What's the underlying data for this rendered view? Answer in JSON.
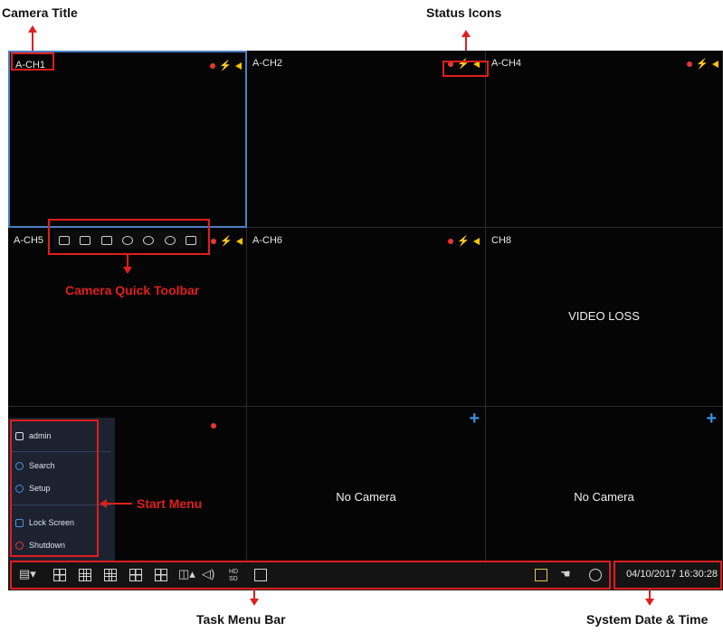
{
  "callouts": {
    "camera_title": "Camera Title",
    "status_icons": "Status Icons",
    "camera_quick_toolbar": "Camera Quick Toolbar",
    "start_menu": "Start Menu",
    "task_menu_bar": "Task Menu Bar",
    "system_date_time": "System Date & Time"
  },
  "cells": [
    {
      "title": "A-CH1",
      "selected": true,
      "status": true
    },
    {
      "title": "A-CH2",
      "status": true
    },
    {
      "title": "A-CH4",
      "status": true
    },
    {
      "title": "A-CH5",
      "status": true
    },
    {
      "title": "A-CH6",
      "status": true
    },
    {
      "title": "CH8",
      "center_text": "VIDEO LOSS"
    },
    {
      "title": "",
      "record_dot": true
    },
    {
      "title": "",
      "center_text": "No Camera",
      "add_icon": "plus-icon"
    },
    {
      "title": "",
      "center_text": "No Camera",
      "add_icon": "plus-icon"
    }
  ],
  "quick_toolbar": {
    "icons": [
      "record-icon",
      "snapshot-icon",
      "playback-icon",
      "ptz-icon",
      "zoom-icon",
      "color-icon",
      "stream-icon"
    ]
  },
  "start_menu": {
    "user": "admin",
    "items": [
      {
        "label": "Search",
        "icon": "search-icon"
      },
      {
        "label": "Setup",
        "icon": "setup-icon"
      },
      {
        "label": "Lock Screen",
        "icon": "lock-icon"
      },
      {
        "label": "Shutdown",
        "icon": "power-icon"
      }
    ]
  },
  "taskbar": {
    "icons": [
      "start-menu-icon",
      "layout-4-icon",
      "layout-9-icon",
      "layout-16-icon",
      "layout-center-icon",
      "layout-split-icon",
      "sequence-icon",
      "volume-icon",
      "hd-sd-icon",
      "camera-settings-icon",
      "network-icon",
      "hand-icon",
      "info-icon"
    ],
    "hd_label": "HD SD"
  },
  "datetime": "04/10/2017 16:30:28",
  "colors": {
    "annotation": "#e01e1e",
    "selected_border": "#4a7fc1",
    "add": "#3d8fe0",
    "alarm": "#e53935"
  }
}
